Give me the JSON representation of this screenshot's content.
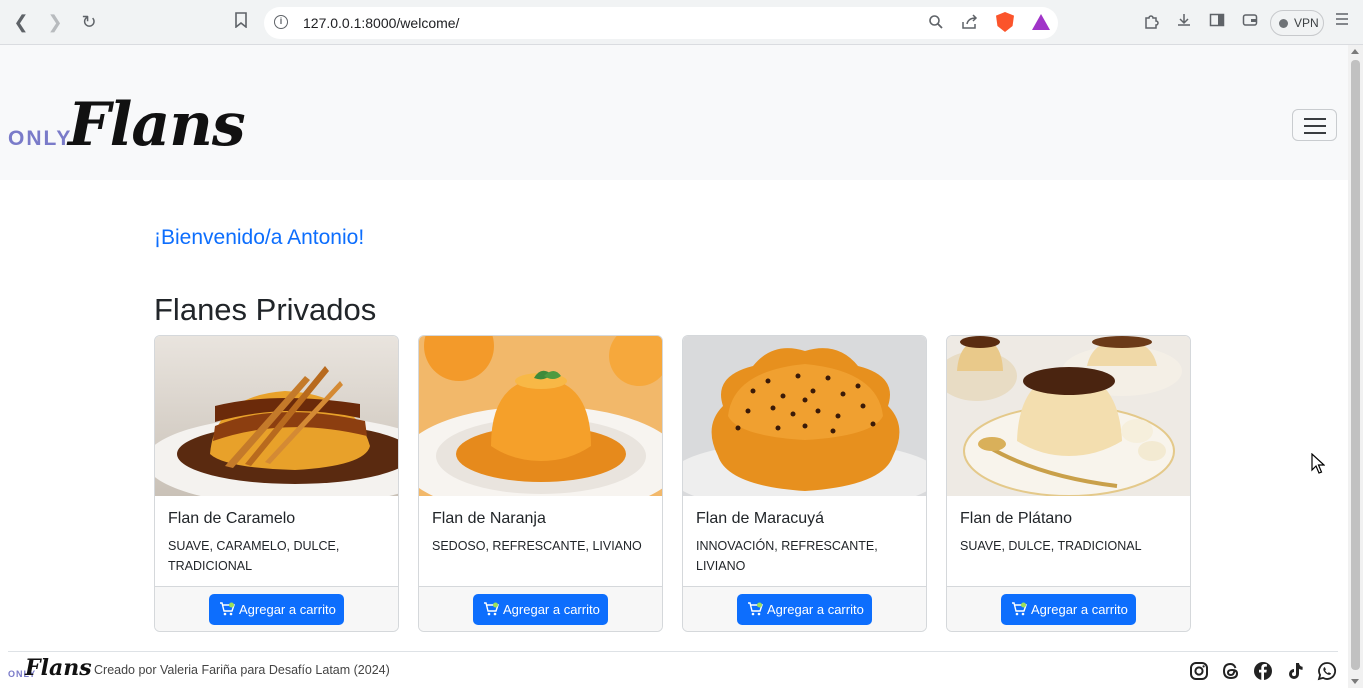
{
  "browser": {
    "url": "127.0.0.1:8000/welcome/",
    "vpn_label": "VPN"
  },
  "site": {
    "logo_small": "ONLY",
    "logo_script": "Flans"
  },
  "welcome": {
    "message": "¡Bienvenido/a Antonio!"
  },
  "section": {
    "title": "Flanes Privados"
  },
  "cards": [
    {
      "title": "Flan de Caramelo",
      "tags": "SUAVE, CARAMELO, DULCE, TRADICIONAL",
      "button": "Agregar a carrito"
    },
    {
      "title": "Flan de Naranja",
      "tags": "SEDOSO, REFRESCANTE, LIVIANO",
      "button": "Agregar a carrito"
    },
    {
      "title": "Flan de Maracuyá",
      "tags": "INNOVACIÓN, REFRESCANTE, LIVIANO",
      "button": "Agregar a carrito"
    },
    {
      "title": "Flan de Plátano",
      "tags": "SUAVE, DULCE, TRADICIONAL",
      "button": "Agregar a carrito"
    }
  ],
  "footer": {
    "credit": "Creado por Valeria Fariña para Desafío Latam (2024)",
    "social_icons": [
      "instagram-icon",
      "threads-icon",
      "facebook-icon",
      "tiktok-icon",
      "whatsapp-icon"
    ]
  },
  "colors": {
    "primary": "#0d6efd",
    "navbar_bg": "#f8f9fa",
    "logo_accent": "#7a7bc9"
  }
}
